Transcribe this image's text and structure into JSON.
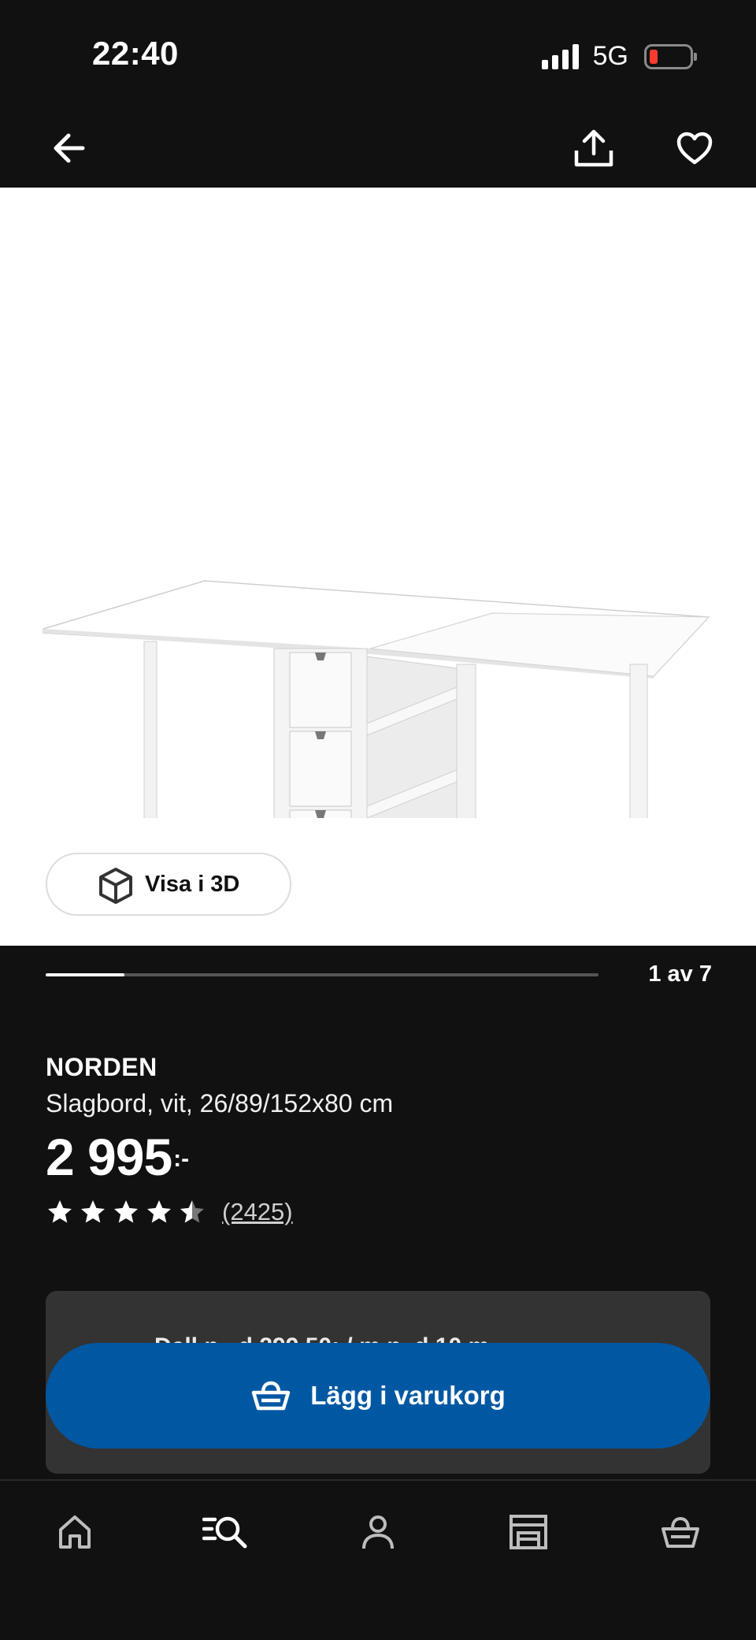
{
  "status_bar": {
    "time": "22:40",
    "network": "5G"
  },
  "top_nav": {
    "back_icon": "arrow-left-icon",
    "share_icon": "share-icon",
    "favorite_icon": "heart-icon"
  },
  "gallery": {
    "view_3d_label": "Visa i 3D",
    "pager_text": "1 av 7",
    "current_index": 1,
    "total": 7
  },
  "product": {
    "name": "NORDEN",
    "description": "Slagbord, vit, 26/89/152x80 cm",
    "price": "2 995",
    "price_suffix": ":-",
    "rating": 4.5,
    "review_count": "(2425)"
  },
  "cta": {
    "hidden_text": "Dell n.. d 299,50: / m n..d 10 m...",
    "add_to_cart_label": "Lägg i varukorg"
  },
  "bottom_nav": {
    "items": [
      "home-icon",
      "search-icon",
      "profile-icon",
      "store-icon",
      "cart-icon"
    ]
  },
  "colors": {
    "brand_blue": "#0058a3",
    "background": "#111111",
    "panel": "#333333"
  }
}
